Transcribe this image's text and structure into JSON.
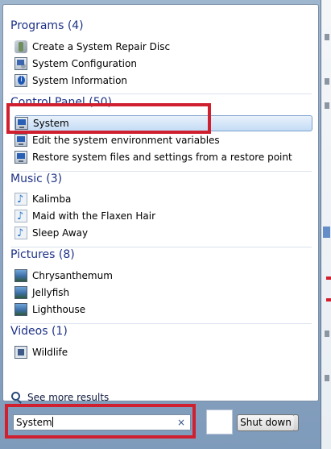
{
  "groups": {
    "programs": {
      "header": "Programs (4)",
      "items": [
        {
          "label": "Create a System Repair Disc",
          "icon": "repair-disc-icon"
        },
        {
          "label": "System Configuration",
          "icon": "system-configuration-icon"
        },
        {
          "label": "System Information",
          "icon": "system-information-icon"
        }
      ]
    },
    "control_panel": {
      "header": "Control Panel (50)",
      "items": [
        {
          "label": "System",
          "icon": "system-icon",
          "selected": true
        },
        {
          "label": "Edit the system environment variables",
          "icon": "system-icon"
        },
        {
          "label": "Restore system files and settings from a restore point",
          "icon": "system-icon"
        }
      ]
    },
    "music": {
      "header": "Music (3)",
      "items": [
        {
          "label": "Kalimba",
          "icon": "music-file-icon"
        },
        {
          "label": "Maid with the Flaxen Hair",
          "icon": "music-file-icon"
        },
        {
          "label": "Sleep Away",
          "icon": "music-file-icon"
        }
      ]
    },
    "pictures": {
      "header": "Pictures (8)",
      "items": [
        {
          "label": "Chrysanthemum",
          "icon": "picture-file-icon"
        },
        {
          "label": "Jellyfish",
          "icon": "picture-file-icon"
        },
        {
          "label": "Lighthouse",
          "icon": "picture-file-icon"
        }
      ]
    },
    "videos": {
      "header": "Videos (1)",
      "items": [
        {
          "label": "Wildlife",
          "icon": "video-file-icon"
        }
      ]
    }
  },
  "see_more": "See more results",
  "search": {
    "value": "System",
    "clear_glyph": "×"
  },
  "shutdown_label": "Shut down",
  "colors": {
    "highlight": "#d01f2e",
    "header_text": "#1e3287",
    "selection": "#c4dcf5"
  }
}
